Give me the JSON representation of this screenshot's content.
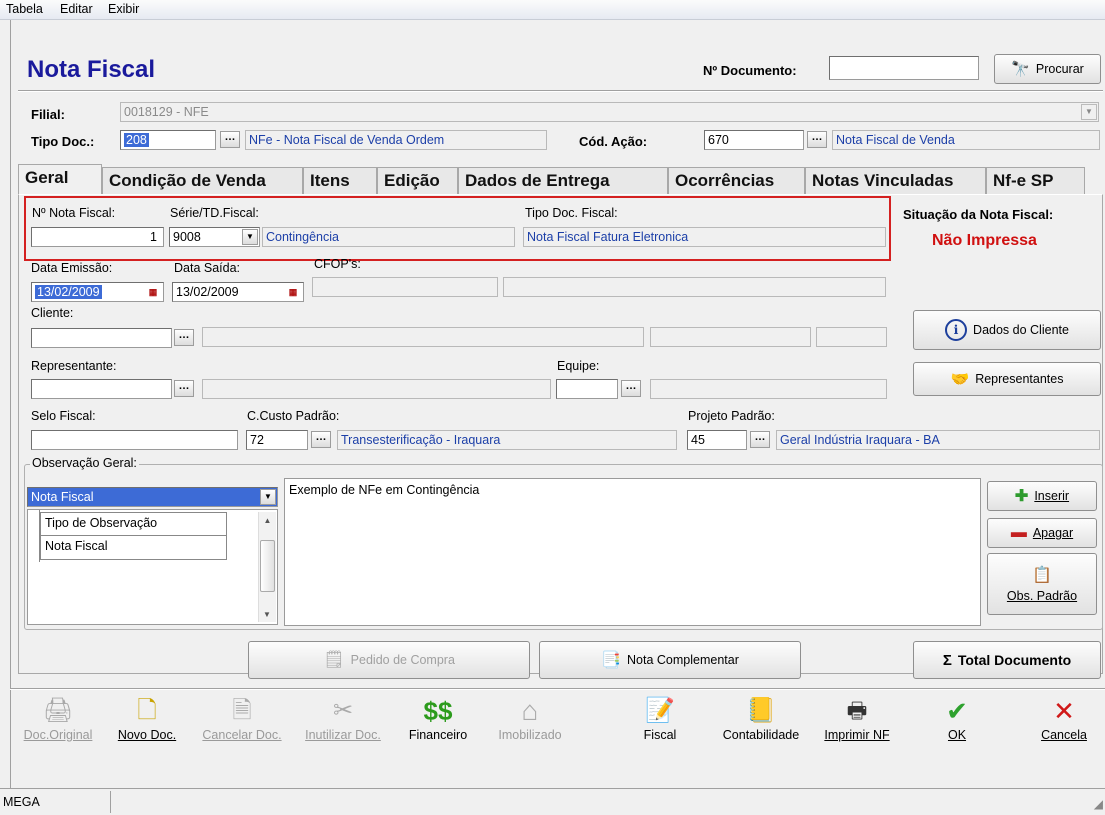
{
  "menu": [
    "Tabela",
    "Editar",
    "Exibir"
  ],
  "header": {
    "title": "Nota Fiscal",
    "doc_number_label": "Nº Documento:",
    "doc_number_value": "",
    "search_button": "Procurar"
  },
  "filial": {
    "label": "Filial:",
    "value": "0018129 - NFE"
  },
  "tipo_doc": {
    "label": "Tipo Doc.:",
    "code": "208",
    "desc": "NFe - Nota Fiscal de Venda Ordem"
  },
  "cod_acao": {
    "label": "Cód. Ação:",
    "code": "670",
    "desc": "Nota Fiscal de Venda"
  },
  "tabs": [
    "Geral",
    "Condição de Venda",
    "Itens",
    "Edição",
    "Dados de Entrega",
    "Ocorrências",
    "Notas Vinculadas",
    "Nf-e SP"
  ],
  "nota": {
    "num_label": "Nº Nota Fiscal:",
    "num_value": "1",
    "serie_label": "Série/TD.Fiscal:",
    "serie_value": "9008",
    "serie_desc": "Contingência",
    "tipo_label": "Tipo Doc. Fiscal:",
    "tipo_value": "Nota Fiscal Fatura Eletronica"
  },
  "situacao": {
    "label": "Situação da Nota Fiscal:",
    "value": "Não Impressa"
  },
  "datas": {
    "emissao_label": "Data Emissão:",
    "emissao_value": "13/02/2009",
    "saida_label": "Data Saída:",
    "saida_value": "13/02/2009",
    "cfop_label": "CFOP's:"
  },
  "cliente_label": "Cliente:",
  "dados_cliente_button": "Dados do Cliente",
  "representante_label": "Representante:",
  "equipe_label": "Equipe:",
  "representantes_button": "Representantes",
  "selo_label": "Selo Fiscal:",
  "ccusto": {
    "label": "C.Custo Padrão:",
    "code": "72",
    "desc": "Transesterificação - Iraquara"
  },
  "projeto": {
    "label": "Projeto Padrão:",
    "code": "45",
    "desc": "Geral Indústria Iraquara - BA"
  },
  "obs": {
    "group_label": "Observação Geral:",
    "combo_value": "Nota Fiscal",
    "grid_header": "Tipo de Observação",
    "grid_rows": [
      "Nota Fiscal"
    ],
    "text": "Exemplo de NFe em Contingência",
    "inserir": "Inserir",
    "apagar": "Apagar",
    "obs_padrao": "Obs. Padrão"
  },
  "actions": {
    "pedido_compra": "Pedido de Compra",
    "nota_complementar": "Nota Complementar",
    "total_documento": "Total Documento"
  },
  "toolbar": [
    {
      "label": "Doc.Original",
      "icon": "doc-original-icon",
      "enabled": false
    },
    {
      "label": "Novo Doc.",
      "icon": "new-doc-icon",
      "enabled": true
    },
    {
      "label": "Cancelar Doc.",
      "icon": "cancel-doc-icon",
      "enabled": false
    },
    {
      "label": "Inutilizar Doc.",
      "icon": "void-doc-icon",
      "enabled": false
    },
    {
      "label": "Financeiro",
      "icon": "money-icon",
      "enabled": true
    },
    {
      "label": "Imobilizado",
      "icon": "house-icon",
      "enabled": false
    },
    {
      "label": "Fiscal",
      "icon": "fiscal-icon",
      "enabled": true
    },
    {
      "label": "Contabilidade",
      "icon": "accounting-icon",
      "enabled": true
    },
    {
      "label": "Imprimir NF",
      "icon": "printer-icon",
      "enabled": true
    },
    {
      "label": "OK",
      "icon": "check-icon",
      "enabled": true
    },
    {
      "label": "Cancela",
      "icon": "cross-icon",
      "enabled": true
    }
  ],
  "status_bar": {
    "text": "MEGA"
  },
  "colors": {
    "title": "#1a1a9c",
    "situacao": "#d01010",
    "highlight_box": "#d42020",
    "link_text": "#1c3fa8"
  }
}
